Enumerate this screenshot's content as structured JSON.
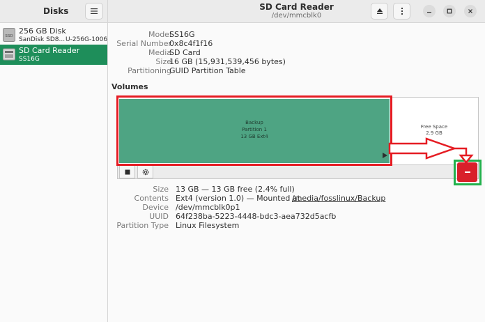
{
  "sidebar": {
    "title": "Disks",
    "menu_icon": "hamburger-menu-icon",
    "disks": [
      {
        "name": "256 GB Disk",
        "subtitle": "SanDisk SD8...",
        "subtitle2": "U-256G-1006",
        "icon": "ssd-icon",
        "icon_label": "SSD",
        "selected": false
      },
      {
        "name": "SD Card Reader",
        "subtitle": "SS16G",
        "icon": "sd-card-icon",
        "selected": true
      }
    ]
  },
  "header": {
    "title": "SD Card Reader",
    "subtitle": "/dev/mmcblk0",
    "eject_icon": "eject-icon",
    "more_icon": "more-vertical-icon",
    "minimize_icon": "minimize-icon",
    "maximize_icon": "maximize-icon",
    "close_icon": "close-icon"
  },
  "drive": {
    "fields": [
      {
        "key": "Model",
        "value": "SS16G"
      },
      {
        "key": "Serial Number",
        "value": "0x8c4f1f16"
      },
      {
        "key": "Media",
        "value": "SD Card"
      },
      {
        "key": "Size",
        "value": "16 GB (15,931,539,456 bytes)"
      },
      {
        "key": "Partitioning",
        "value": "GUID Partition Table"
      }
    ]
  },
  "volumes": {
    "title": "Volumes",
    "partition": {
      "label": "Backup",
      "sub": "Partition 1",
      "detail": "13 GB Ext4"
    },
    "free_space": {
      "label": "Free Space",
      "size": "2.9 GB"
    },
    "stop_icon": "stop-icon",
    "settings_icon": "gear-icon",
    "delete_icon": "minus-icon",
    "colors": {
      "partition": "#4ea483",
      "selected": "#1e8e5a",
      "delete": "#d9202a",
      "annotation_red": "#e51c23",
      "annotation_green": "#22b14c"
    }
  },
  "partition_details": {
    "size_key": "Size",
    "size_val": "13 GB — 13 GB free (2.4% full)",
    "contents_key": "Contents",
    "contents_val": "Ext4 (version 1.0) — Mounted at",
    "contents_link": "/media/fosslinux/Backup",
    "device_key": "Device",
    "device_val": "/dev/mmcblk0p1",
    "uuid_key": "UUID",
    "uuid_val": "64f238ba-5223-4448-bdc3-aea732d5acfb",
    "type_key": "Partition Type",
    "type_val": "Linux Filesystem"
  }
}
